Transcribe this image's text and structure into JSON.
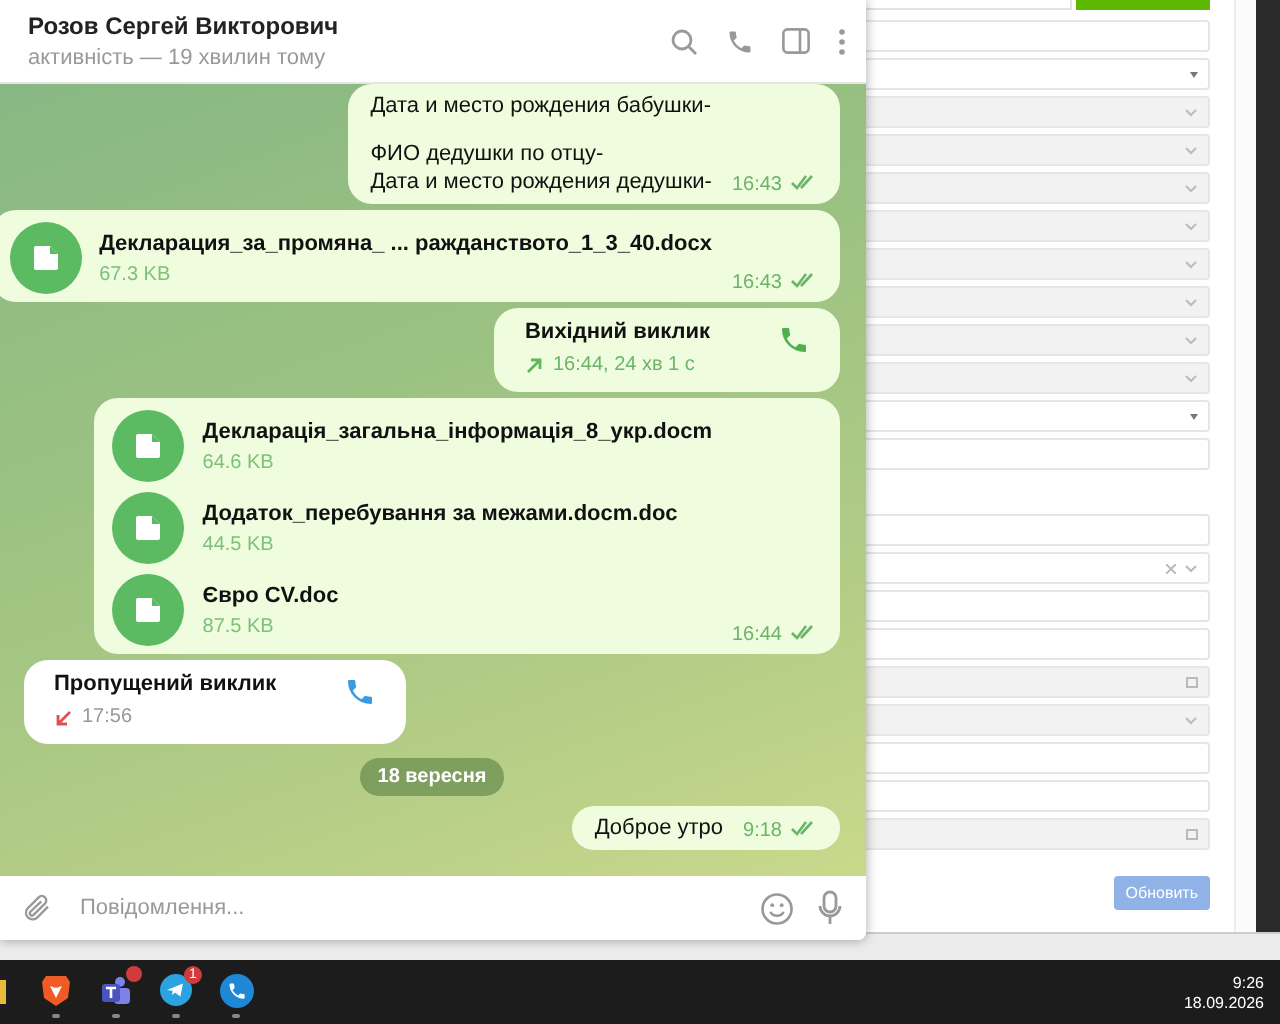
{
  "form": {
    "fields": [
      {
        "kind": "text"
      },
      {
        "kind": "select"
      },
      {
        "kind": "locked"
      },
      {
        "kind": "locked"
      },
      {
        "kind": "locked"
      },
      {
        "kind": "locked"
      },
      {
        "kind": "locked"
      },
      {
        "kind": "locked"
      },
      {
        "kind": "locked"
      },
      {
        "kind": "locked"
      },
      {
        "kind": "select"
      },
      {
        "kind": "text"
      },
      {
        "kind": "gap"
      },
      {
        "kind": "text"
      },
      {
        "kind": "clearable"
      },
      {
        "kind": "text"
      },
      {
        "kind": "text"
      },
      {
        "kind": "date"
      },
      {
        "kind": "locked"
      },
      {
        "kind": "text"
      },
      {
        "kind": "text"
      },
      {
        "kind": "date"
      }
    ],
    "button": "Обновить"
  },
  "chat": {
    "name": "Розов Сергей Викторович",
    "status": "активність — 19 хвилин тому"
  },
  "messages": [
    {
      "kind": "text",
      "outgoing": true,
      "paragraphs": [
        [
          "Дата и место рождения бабушки-"
        ],
        [
          "ФИО дедушки по отцу-",
          "Дата и место рождения дедушки-"
        ]
      ],
      "time": "16:43",
      "read": true
    },
    {
      "kind": "files",
      "outgoing": true,
      "files": [
        {
          "name": "Декларация_за_промяна_ ... ражданството_1_3_40.docx",
          "size": "67.3 KB"
        }
      ],
      "time": "16:43",
      "read": true
    },
    {
      "kind": "call",
      "outgoing": true,
      "missed": false,
      "title": "Вихідний виклик",
      "detail": "16:44, 24 хв 1 с"
    },
    {
      "kind": "files",
      "outgoing": true,
      "files": [
        {
          "name": "Декларація_загальна_інформація_8_укр.docm",
          "size": "64.6 KB"
        },
        {
          "name": "Додаток_перебування за межами.docm.doc",
          "size": "44.5 KB"
        },
        {
          "name": "Євро CV.doc",
          "size": "87.5 KB"
        }
      ],
      "time": "16:44",
      "read": true
    },
    {
      "kind": "call",
      "outgoing": false,
      "missed": true,
      "title": "Пропущений виклик",
      "detail": "17:56"
    },
    {
      "kind": "date",
      "label": "18 вересня"
    },
    {
      "kind": "text",
      "outgoing": true,
      "paragraphs": [
        [
          "Доброе утро"
        ]
      ],
      "time": "9:18",
      "read": true
    }
  ],
  "composer": {
    "placeholder": "Повідомлення..."
  },
  "taskbar": {
    "apps": [
      {
        "kind": "brave",
        "notification": false
      },
      {
        "kind": "teams",
        "notification": true
      },
      {
        "kind": "telegram",
        "notification": true,
        "badge": "1"
      },
      {
        "kind": "phone",
        "notification": false
      }
    ],
    "time": "9:26",
    "date": "18.09.2026"
  }
}
